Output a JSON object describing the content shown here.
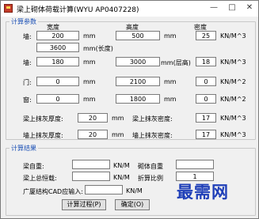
{
  "window": {
    "title": "梁上砌体荷载计算(WYU AP0407228)",
    "minimize_glyph": "—",
    "maximize_glyph": "□",
    "close_glyph": "✕"
  },
  "params": {
    "group_title": "计算参数",
    "headers": {
      "width": "宽度",
      "height": "高度",
      "density": "密度"
    },
    "wall": {
      "label": "墙:",
      "width": "200",
      "width_unit": "mm",
      "height": "500",
      "height_unit": "mm",
      "density": "25",
      "density_unit": "KN/M^3",
      "length": "3600",
      "length_unit": "mm(长度)"
    },
    "brick": {
      "label": "墙:",
      "width": "180",
      "width_unit": "mm",
      "height": "3000",
      "height_unit": "mm(层高)",
      "density": "18",
      "density_unit": "KN/M^3"
    },
    "door": {
      "label": "门:",
      "width": "0",
      "width_unit": "mm",
      "height": "2100",
      "height_unit": "mm",
      "density": "0",
      "density_unit": "KN/M^2"
    },
    "window_row": {
      "label": "窗:",
      "width": "0",
      "width_unit": "mm",
      "height": "1800",
      "height_unit": "mm",
      "density": "0",
      "density_unit": "KN/M^2"
    },
    "plaster_thick_top": {
      "label": "梁上抹灰厚度:",
      "value": "20",
      "unit": "mm",
      "density_label": "梁上抹灰密度:",
      "density": "17",
      "density_unit": "KN/M^3"
    },
    "plaster_thick_wall": {
      "label": "墙上抹灰厚度:",
      "value": "20",
      "unit": "mm",
      "density_label": "墙上抹灰密度:",
      "density": "17",
      "density_unit": "KN/M^3"
    }
  },
  "results": {
    "group_title": "计算结果",
    "self_weight_label": "梁自重:",
    "self_weight_value": "",
    "self_weight_unit": "KN/M",
    "wall_self_weight_label": "砌体自重",
    "wall_self_weight_value": "",
    "total_load_label": "梁上总恒载:",
    "total_load_value": "",
    "total_load_unit": "KN/M",
    "ratio_label": "折算比例",
    "ratio_value": "1",
    "cad_label": "广厦结构CAD应输入:",
    "cad_value": "",
    "cad_unit": "KN/M"
  },
  "buttons": {
    "process": "计算过程(P)",
    "ok": "确定(O)"
  },
  "watermark": "最需网"
}
